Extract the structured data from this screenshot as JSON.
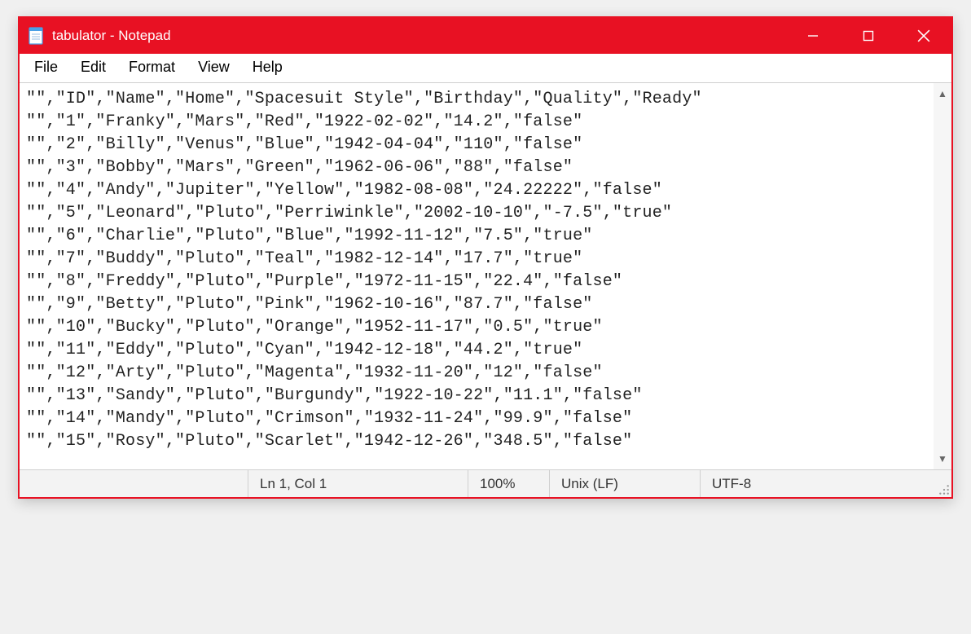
{
  "titlebar": {
    "title": "tabulator - Notepad"
  },
  "menubar": {
    "items": [
      "File",
      "Edit",
      "Format",
      "View",
      "Help"
    ]
  },
  "document": {
    "lines": [
      "\"\",\"ID\",\"Name\",\"Home\",\"Spacesuit Style\",\"Birthday\",\"Quality\",\"Ready\"",
      "\"\",\"1\",\"Franky\",\"Mars\",\"Red\",\"1922-02-02\",\"14.2\",\"false\"",
      "\"\",\"2\",\"Billy\",\"Venus\",\"Blue\",\"1942-04-04\",\"110\",\"false\"",
      "\"\",\"3\",\"Bobby\",\"Mars\",\"Green\",\"1962-06-06\",\"88\",\"false\"",
      "\"\",\"4\",\"Andy\",\"Jupiter\",\"Yellow\",\"1982-08-08\",\"24.22222\",\"false\"",
      "\"\",\"5\",\"Leonard\",\"Pluto\",\"Perriwinkle\",\"2002-10-10\",\"-7.5\",\"true\"",
      "\"\",\"6\",\"Charlie\",\"Pluto\",\"Blue\",\"1992-11-12\",\"7.5\",\"true\"",
      "\"\",\"7\",\"Buddy\",\"Pluto\",\"Teal\",\"1982-12-14\",\"17.7\",\"true\"",
      "\"\",\"8\",\"Freddy\",\"Pluto\",\"Purple\",\"1972-11-15\",\"22.4\",\"false\"",
      "\"\",\"9\",\"Betty\",\"Pluto\",\"Pink\",\"1962-10-16\",\"87.7\",\"false\"",
      "\"\",\"10\",\"Bucky\",\"Pluto\",\"Orange\",\"1952-11-17\",\"0.5\",\"true\"",
      "\"\",\"11\",\"Eddy\",\"Pluto\",\"Cyan\",\"1942-12-18\",\"44.2\",\"true\"",
      "\"\",\"12\",\"Arty\",\"Pluto\",\"Magenta\",\"1932-11-20\",\"12\",\"false\"",
      "\"\",\"13\",\"Sandy\",\"Pluto\",\"Burgundy\",\"1922-10-22\",\"11.1\",\"false\"",
      "\"\",\"14\",\"Mandy\",\"Pluto\",\"Crimson\",\"1932-11-24\",\"99.9\",\"false\"",
      "\"\",\"15\",\"Rosy\",\"Pluto\",\"Scarlet\",\"1942-12-26\",\"348.5\",\"false\""
    ]
  },
  "statusbar": {
    "position": "Ln 1, Col 1",
    "zoom": "100%",
    "eol": "Unix (LF)",
    "encoding": "UTF-8"
  }
}
